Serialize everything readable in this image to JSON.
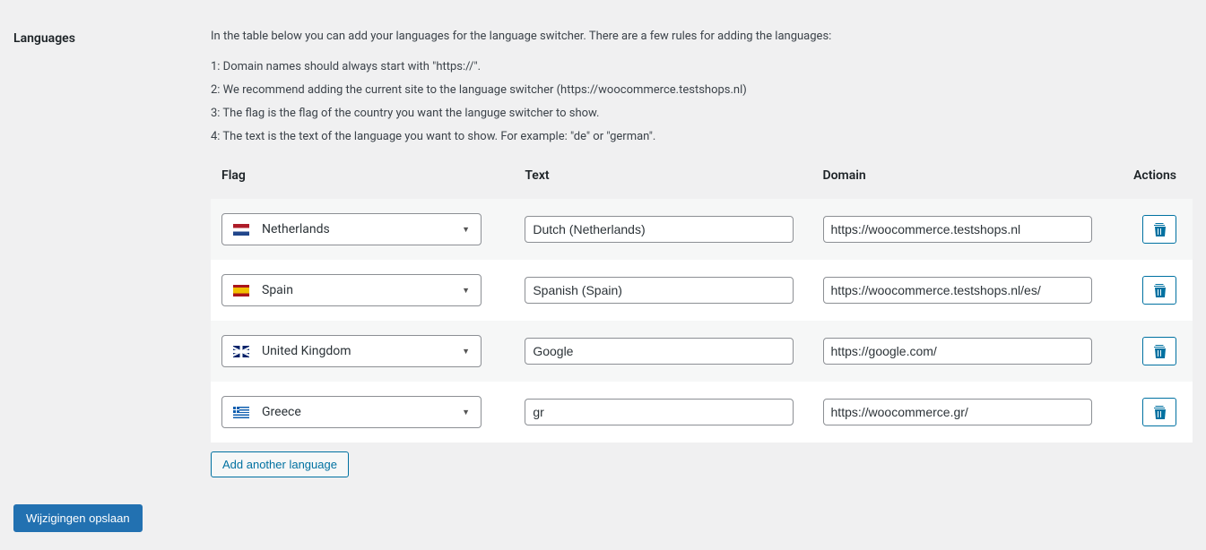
{
  "section_label": "Languages",
  "description": {
    "intro": "In the table below you can add your languages for the language switcher. There are a few rules for adding the languages:",
    "rule1": "1: Domain names should always start with \"https://\".",
    "rule2": "2: We recommend adding the current site to the language switcher (https://woocommerce.testshops.nl)",
    "rule3": "3: The flag is the flag of the country you want the languge switcher to show.",
    "rule4": "4: The text is the text of the language you want to show. For example: \"de\" or \"german\"."
  },
  "headers": {
    "flag": "Flag",
    "text": "Text",
    "domain": "Domain",
    "actions": "Actions"
  },
  "rows": [
    {
      "flag_code": "nl",
      "flag_label": "Netherlands",
      "text": "Dutch (Netherlands)",
      "domain": "https://woocommerce.testshops.nl"
    },
    {
      "flag_code": "es",
      "flag_label": "Spain",
      "text": "Spanish (Spain)",
      "domain": "https://woocommerce.testshops.nl/es/"
    },
    {
      "flag_code": "gb",
      "flag_label": "United Kingdom",
      "text": "Google",
      "domain": "https://google.com/"
    },
    {
      "flag_code": "gr",
      "flag_label": "Greece",
      "text": "gr",
      "domain": "https://woocommerce.gr/"
    }
  ],
  "add_button": "Add another language",
  "save_button": "Wijzigingen opslaan"
}
